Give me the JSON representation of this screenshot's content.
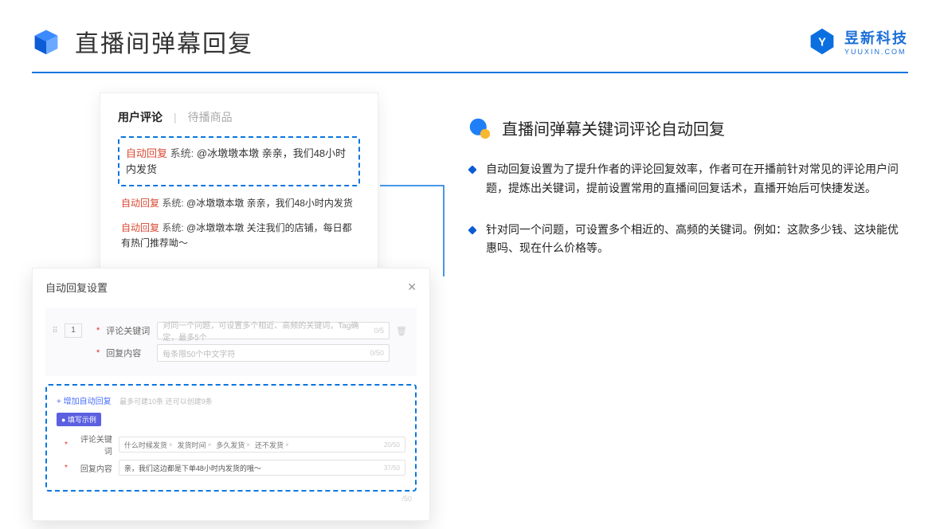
{
  "header": {
    "title": "直播间弹幕回复",
    "brand_name": "昱新科技",
    "brand_sub": "YUUXIN.COM"
  },
  "comments_card": {
    "tab_active": "用户评论",
    "tab_inactive": "待播商品",
    "highlighted": {
      "tag": "自动回复",
      "sys": "系统:",
      "msg": "@冰墩墩本墩 亲亲，我们48小时内发货"
    },
    "rows": [
      {
        "tag": "自动回复",
        "sys": "系统:",
        "msg": "@冰墩墩本墩 亲亲，我们48小时内发货"
      },
      {
        "tag": "自动回复",
        "sys": "系统:",
        "msg": "@冰墩墩本墩 关注我们的店铺，每日都有热门推荐呦～"
      }
    ]
  },
  "settings": {
    "title": "自动回复设置",
    "order": "1",
    "kw_label": "评论关键词",
    "kw_placeholder": "对同一个问题，可设置多个相近、高频的关键词，Tag确定，最多5个",
    "kw_count": "0/5",
    "content_label": "回复内容",
    "content_placeholder": "每条限50个中文字符",
    "content_count": "0/50",
    "add_link": "+ 增加自动回复",
    "add_note": "最多可建10条 还可以创建9条",
    "example_badge": "● 填写示例",
    "ex_kw_label": "评论关键词",
    "ex_tags": [
      "什么时候发货",
      "发货时间",
      "多久发货",
      "还不发货"
    ],
    "ex_kw_count": "20/50",
    "ex_content_label": "回复内容",
    "ex_content_value": "亲，我们这边都是下单48小时内发货的哦～",
    "ex_content_count": "37/50",
    "trailing_count": "/50"
  },
  "right": {
    "subtitle": "直播间弹幕关键词评论自动回复",
    "bullets": [
      "自动回复设置为了提升作者的评论回复效率，作者可在开播前针对常见的评论用户问题，提炼出关键词，提前设置常用的直播间回复话术，直播开始后可快捷发送。",
      "针对同一个问题，可设置多个相近的、高频的关键词。例如：这款多少钱、这块能优惠吗、现在什么价格等。"
    ]
  }
}
